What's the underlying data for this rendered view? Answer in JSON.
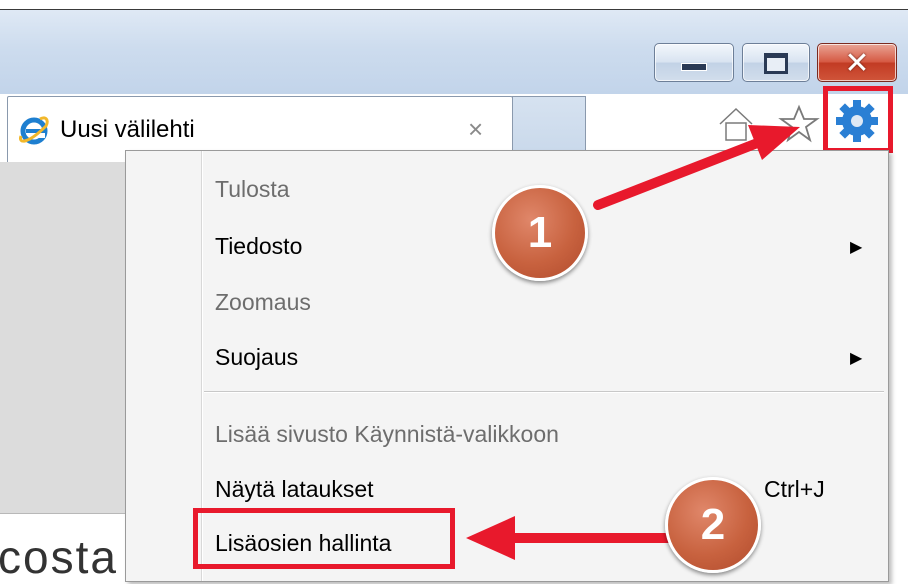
{
  "window": {
    "min_glyph": "–",
    "close_glyph": "✕"
  },
  "tab": {
    "label": "Uusi välilehti",
    "close_glyph": "×",
    "icon": "ie-icon"
  },
  "toolbar": {
    "icons": [
      "home-icon",
      "star-icon",
      "gear-icon"
    ]
  },
  "menu": {
    "items": [
      {
        "label": "Tulosta",
        "enabled": false
      },
      {
        "label": "Tiedosto",
        "enabled": true,
        "submenu": true
      },
      {
        "label": "Zoomaus",
        "enabled": false
      },
      {
        "label": "Suojaus",
        "enabled": true,
        "submenu": true
      },
      {
        "label": "Lisää sivusto Käynnistä-valikkoon",
        "enabled": false
      },
      {
        "label": "Näytä lataukset",
        "enabled": true,
        "shortcut": "Ctrl+J"
      },
      {
        "label": "Lisäosien hallinta",
        "enabled": true
      }
    ],
    "submenu_glyph": "▶"
  },
  "annotations": {
    "callout1": "1",
    "callout2": "2",
    "highlight_color": "#e8192c",
    "callout_color": "#c8623f"
  },
  "page": {
    "partial_text": "costa"
  }
}
